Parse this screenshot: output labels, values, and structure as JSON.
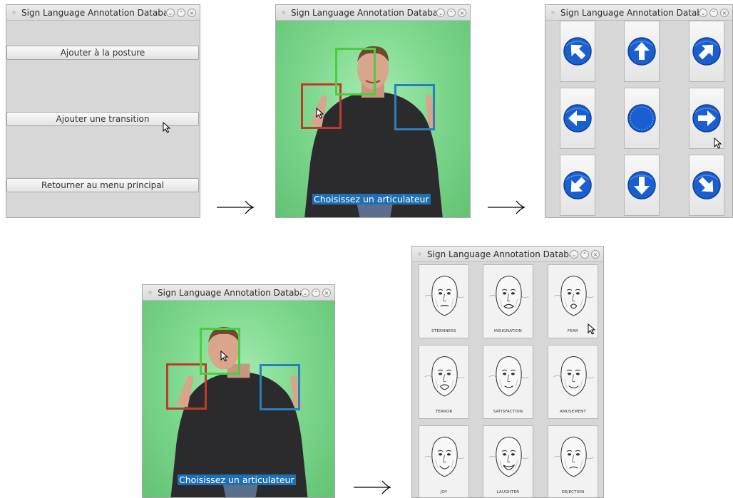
{
  "window_title": "Sign Language Annotation Database",
  "menu": {
    "add_posture": "Ajouter à la posture",
    "add_transition": "Ajouter une transition",
    "back_main": "Retourner au menu principal"
  },
  "video": {
    "caption": "Choisissez un articulateur"
  },
  "direction_icons": [
    "arrow-up-left-icon",
    "arrow-up-icon",
    "arrow-up-right-icon",
    "arrow-left-icon",
    "circle-center-icon",
    "arrow-right-icon",
    "arrow-down-left-icon",
    "arrow-down-icon",
    "arrow-down-right-icon"
  ],
  "expressions": [
    "STERNNESS",
    "INDIGNATION",
    "FEAR",
    "TERROR",
    "SATISFACTION",
    "AMUSEMENT",
    "JOY",
    "LAUGHTER",
    "DEJECTION"
  ],
  "colors": {
    "box_right_hand": "#c0392b",
    "box_face": "#4ccd40",
    "box_left_hand": "#2a7fbf",
    "caption_bg": "#1f6fb3",
    "arrow_blue": "#1a5fd0"
  }
}
